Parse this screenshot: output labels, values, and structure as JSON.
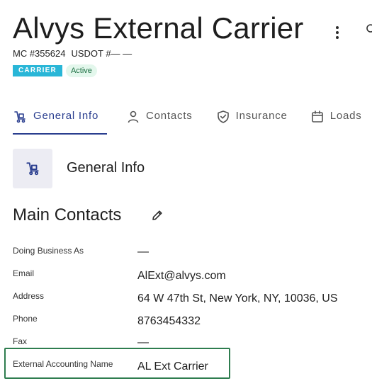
{
  "header": {
    "title": "Alvys External Carrier",
    "mc_number": "MC #355624",
    "usdot": "USDOT #— —",
    "badges": {
      "type": "CARRIER",
      "status": "Active"
    },
    "menu_icon": "more-vert-icon"
  },
  "tabs": [
    {
      "label": "General Info",
      "icon": "truck-icon",
      "active": true
    },
    {
      "label": "Contacts",
      "icon": "person-icon",
      "active": false
    },
    {
      "label": "Insurance",
      "icon": "shield-check-icon",
      "active": false
    },
    {
      "label": "Loads",
      "icon": "calendar-icon",
      "active": false
    }
  ],
  "section": {
    "title": "General Info",
    "icon": "truck-icon"
  },
  "main_contacts": {
    "title": "Main Contacts",
    "edit_icon": "pencil-icon",
    "fields": [
      {
        "label": "Doing Business As",
        "value": "—"
      },
      {
        "label": "Email",
        "value": "AlExt@alvys.com"
      },
      {
        "label": "Address",
        "value": "64 W 47th St, New York, NY, 10036, US"
      },
      {
        "label": "Phone",
        "value": "8763454332"
      },
      {
        "label": "Fax",
        "value": "—"
      },
      {
        "label": "External Accounting Name",
        "value": "AL Ext Carrier",
        "highlighted": true
      }
    ]
  },
  "colors": {
    "accent": "#2a3e8f",
    "carrier_badge": "#29b6d7",
    "active_badge_bg": "#e3f7ec",
    "active_badge_text": "#1b6e42",
    "highlight_border": "#2e7d4f"
  }
}
